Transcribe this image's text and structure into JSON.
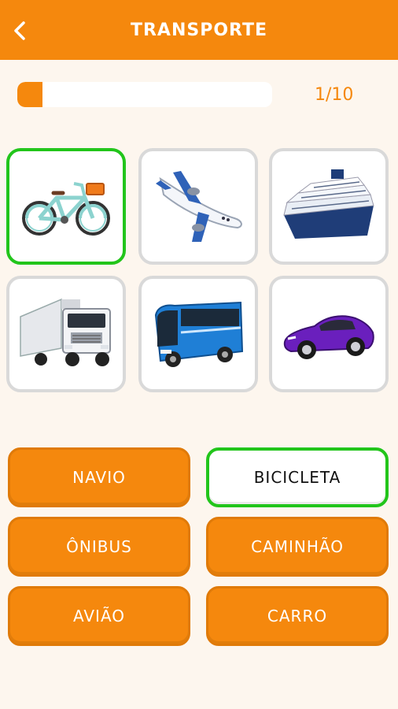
{
  "header": {
    "title": "TRANSPORTE",
    "back_icon": "chevron-left-icon"
  },
  "progress": {
    "label": "1/10",
    "fraction": 0.1
  },
  "colors": {
    "accent": "#f5880d",
    "correct": "#22c51b",
    "card_border": "#d9d9d9",
    "background": "#fdf6ee"
  },
  "images": [
    {
      "name": "bicycle",
      "selected": true
    },
    {
      "name": "airplane",
      "selected": false
    },
    {
      "name": "cruise-ship",
      "selected": false
    },
    {
      "name": "truck",
      "selected": false
    },
    {
      "name": "bus",
      "selected": false
    },
    {
      "name": "car",
      "selected": false
    }
  ],
  "answers": [
    {
      "label": "NAVIO",
      "selected": false
    },
    {
      "label": "BICICLETA",
      "selected": true
    },
    {
      "label": "ÔNIBUS",
      "selected": false
    },
    {
      "label": "CAMINHÃO",
      "selected": false
    },
    {
      "label": "AVIÃO",
      "selected": false
    },
    {
      "label": "CARRO",
      "selected": false
    }
  ]
}
